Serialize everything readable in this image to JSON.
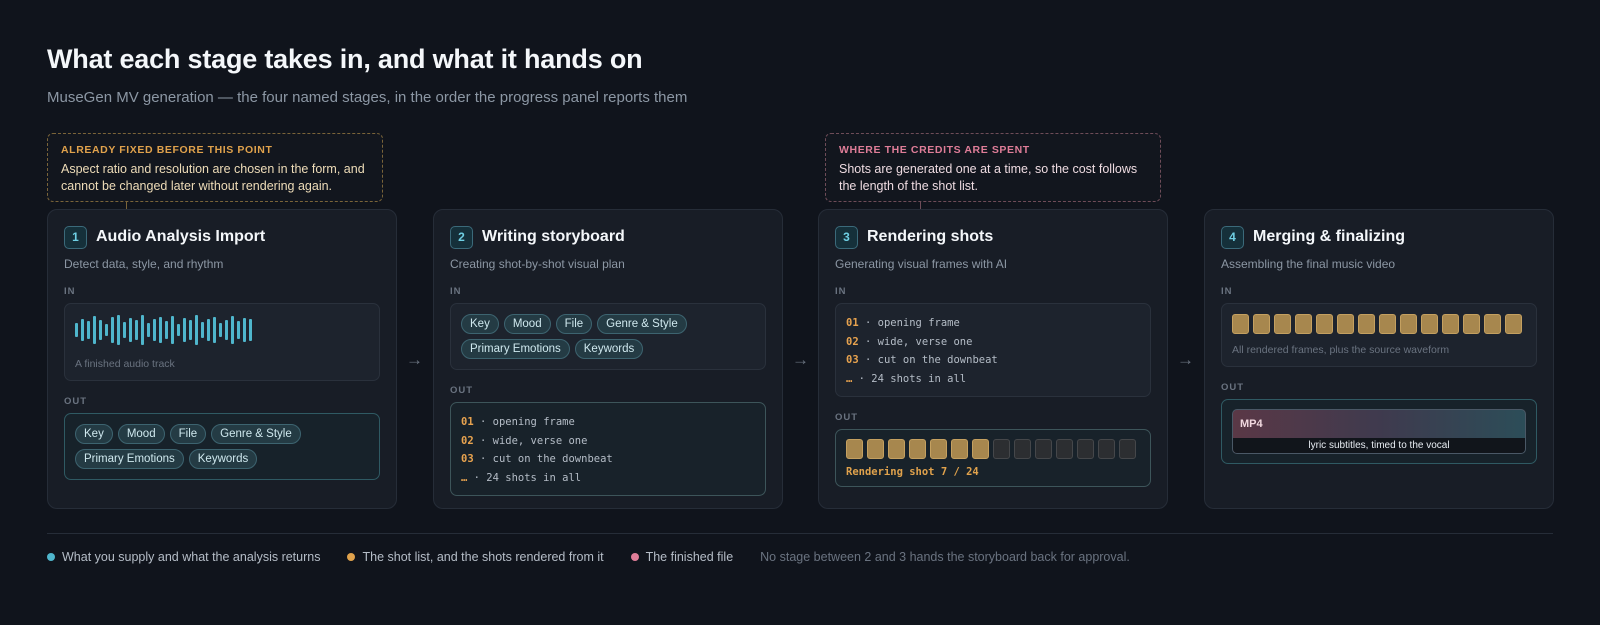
{
  "header": {
    "title": "What each stage takes in, and what it hands on",
    "subtitle": "MuseGen MV generation — the four named stages, in the order the progress panel reports them"
  },
  "callouts": [
    {
      "label": "ALREADY FIXED BEFORE THIS POINT",
      "text": "Aspect ratio and resolution are chosen in the form, and cannot be changed later without rendering again.",
      "color": "#e0a24c"
    },
    {
      "label": "WHERE THE CREDITS ARE SPENT",
      "text": "Shots are generated one at a time, so the cost follows the length of the shot list.",
      "color": "#df7d98"
    }
  ],
  "io_labels": {
    "in": "IN",
    "out": "OUT"
  },
  "arrow": "→",
  "stages": [
    {
      "number": "1",
      "title": "Audio Analysis Import",
      "subtitle": "Detect data, style, and rhythm",
      "in_caption": "A finished audio track",
      "out_chips": [
        "Key",
        "Mood",
        "File",
        "Genre & Style",
        "Primary Emotions",
        "Keywords"
      ]
    },
    {
      "number": "2",
      "title": "Writing storyboard",
      "subtitle": "Creating shot-by-shot visual plan",
      "in_chips": [
        "Key",
        "Mood",
        "File",
        "Genre & Style",
        "Primary Emotions",
        "Keywords"
      ],
      "out_shots": [
        {
          "n": "01",
          "text": " · opening frame"
        },
        {
          "n": "02",
          "text": " · wide, verse one"
        },
        {
          "n": "03",
          "text": " · cut on the downbeat"
        },
        {
          "n": "…",
          "text": " · 24 shots in all"
        }
      ]
    },
    {
      "number": "3",
      "title": "Rendering shots",
      "subtitle": "Generating visual frames with AI",
      "in_shots": [
        {
          "n": "01",
          "text": " · opening frame"
        },
        {
          "n": "02",
          "text": " · wide, verse one"
        },
        {
          "n": "03",
          "text": " · cut on the downbeat"
        },
        {
          "n": "…",
          "text": " · 24 shots in all"
        }
      ],
      "render_status": "Rendering shot 7 / 24",
      "frames_done": 7,
      "frames_shown": 14
    },
    {
      "number": "4",
      "title": "Merging & finalizing",
      "subtitle": "Assembling the final music video",
      "in_caption": "All rendered frames, plus the source waveform",
      "frames_shown": 14,
      "mp4_label": "MP4",
      "mp4_caption": "lyric subtitles, timed to the vocal"
    }
  ],
  "legend": {
    "items": [
      {
        "label": "What you supply and what the analysis returns",
        "color": "#4fb6cc"
      },
      {
        "label": "The shot list, and the shots rendered from it",
        "color": "#e0a24c"
      },
      {
        "label": "The finished file",
        "color": "#df7d98"
      }
    ],
    "note": "No stage between 2 and 3 hands the storyboard back for approval."
  }
}
